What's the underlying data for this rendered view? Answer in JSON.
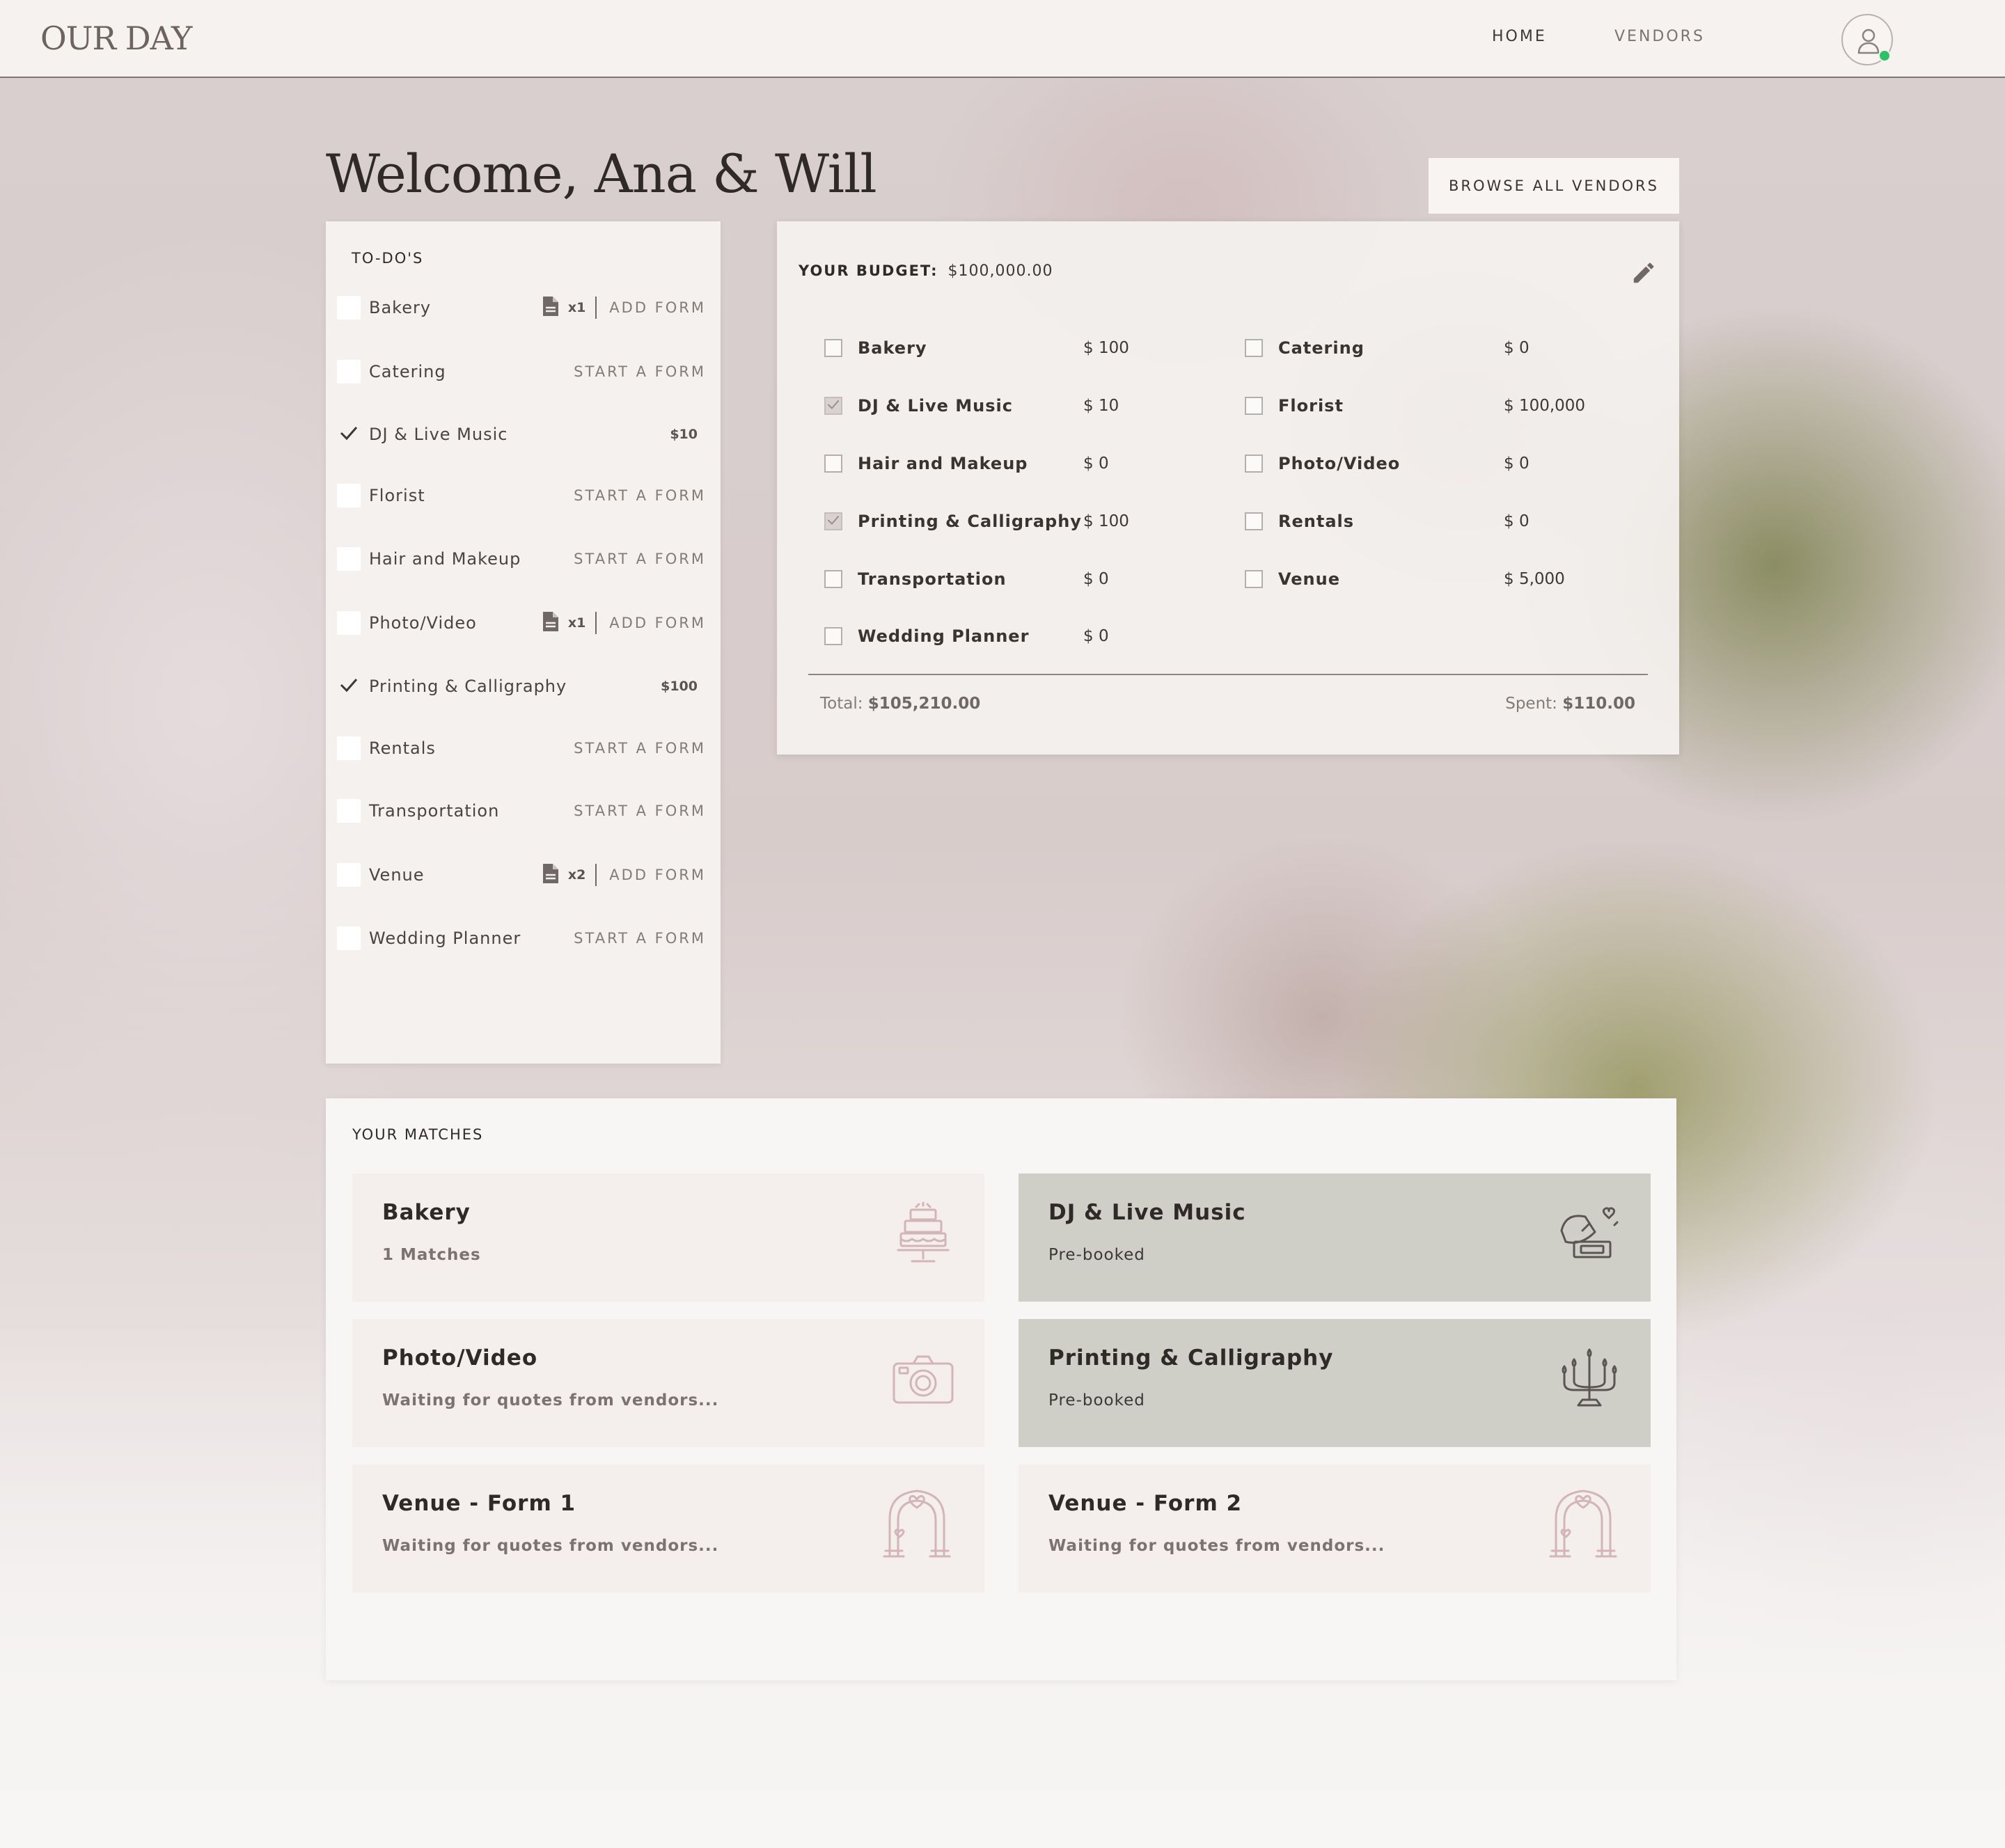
{
  "header": {
    "logo": "OUR DAY",
    "nav": [
      {
        "label": "HOME"
      },
      {
        "label": "VENDORS"
      }
    ],
    "avatar_icon": "user-icon",
    "status_color": "#2fc06a"
  },
  "welcome": "Welcome, Ana & Will",
  "browse_button": "BROWSE ALL VENDORS",
  "todos": {
    "title": "TO-DO'S",
    "items": [
      {
        "label": "Bakery",
        "checked": false,
        "type": "form",
        "count": "x1",
        "action": "ADD FORM"
      },
      {
        "label": "Catering",
        "checked": false,
        "type": "start",
        "action": "START A FORM"
      },
      {
        "label": "DJ & Live Music",
        "checked": true,
        "type": "amount",
        "amount": "$10"
      },
      {
        "label": "Florist",
        "checked": false,
        "type": "start",
        "action": "START A FORM"
      },
      {
        "label": "Hair and Makeup",
        "checked": false,
        "type": "start",
        "action": "START A FORM"
      },
      {
        "label": "Photo/Video",
        "checked": false,
        "type": "form",
        "count": "x1",
        "action": "ADD FORM"
      },
      {
        "label": "Printing & Calligraphy",
        "checked": true,
        "type": "amount",
        "amount": "$100"
      },
      {
        "label": "Rentals",
        "checked": false,
        "type": "start",
        "action": "START A FORM"
      },
      {
        "label": "Transportation",
        "checked": false,
        "type": "start",
        "action": "START A FORM"
      },
      {
        "label": "Venue",
        "checked": false,
        "type": "form",
        "count": "x2",
        "action": "ADD FORM"
      },
      {
        "label": "Wedding Planner",
        "checked": false,
        "type": "start",
        "action": "START A FORM"
      }
    ]
  },
  "budget": {
    "label": "YOUR BUDGET:",
    "value": "$100,000.00",
    "left": [
      {
        "name": "Bakery",
        "amount": "$ 100",
        "checked": false
      },
      {
        "name": "DJ & Live Music",
        "amount": "$ 10",
        "checked": true
      },
      {
        "name": "Hair and Makeup",
        "amount": "$ 0",
        "checked": false
      },
      {
        "name": "Printing & Calligraphy",
        "amount": "$ 100",
        "checked": true
      },
      {
        "name": "Transportation",
        "amount": "$ 0",
        "checked": false
      },
      {
        "name": "Wedding Planner",
        "amount": "$ 0",
        "checked": false
      }
    ],
    "right": [
      {
        "name": "Catering",
        "amount": "$ 0",
        "checked": false
      },
      {
        "name": "Florist",
        "amount": "$ 100,000",
        "checked": false
      },
      {
        "name": "Photo/Video",
        "amount": "$ 0",
        "checked": false
      },
      {
        "name": "Rentals",
        "amount": "$ 0",
        "checked": false
      },
      {
        "name": "Venue",
        "amount": "$ 5,000",
        "checked": false
      }
    ],
    "total_label": "Total:",
    "total_value": "$105,210.00",
    "spent_label": "Spent:",
    "spent_value": "$110.00"
  },
  "matches": {
    "title": "YOUR MATCHES",
    "cards": [
      {
        "title": "Bakery",
        "subtitle": "1 Matches",
        "booked": false,
        "icon": "cake-icon"
      },
      {
        "title": "DJ & Live Music",
        "subtitle": "Pre-booked",
        "booked": true,
        "icon": "gramophone-icon"
      },
      {
        "title": "Photo/Video",
        "subtitle": "Waiting for quotes from vendors...",
        "booked": false,
        "icon": "camera-icon"
      },
      {
        "title": "Printing & Calligraphy",
        "subtitle": "Pre-booked",
        "booked": true,
        "icon": "candelabra-icon"
      },
      {
        "title": "Venue - Form 1",
        "subtitle": "Waiting for quotes from vendors...",
        "booked": false,
        "icon": "arch-icon"
      },
      {
        "title": "Venue - Form 2",
        "subtitle": "Waiting for quotes from vendors...",
        "booked": false,
        "icon": "arch-icon"
      }
    ]
  },
  "colors": {
    "accent_pink": "#d3b4b7",
    "booked_card": "#cfcec7",
    "card": "#f4efed"
  }
}
